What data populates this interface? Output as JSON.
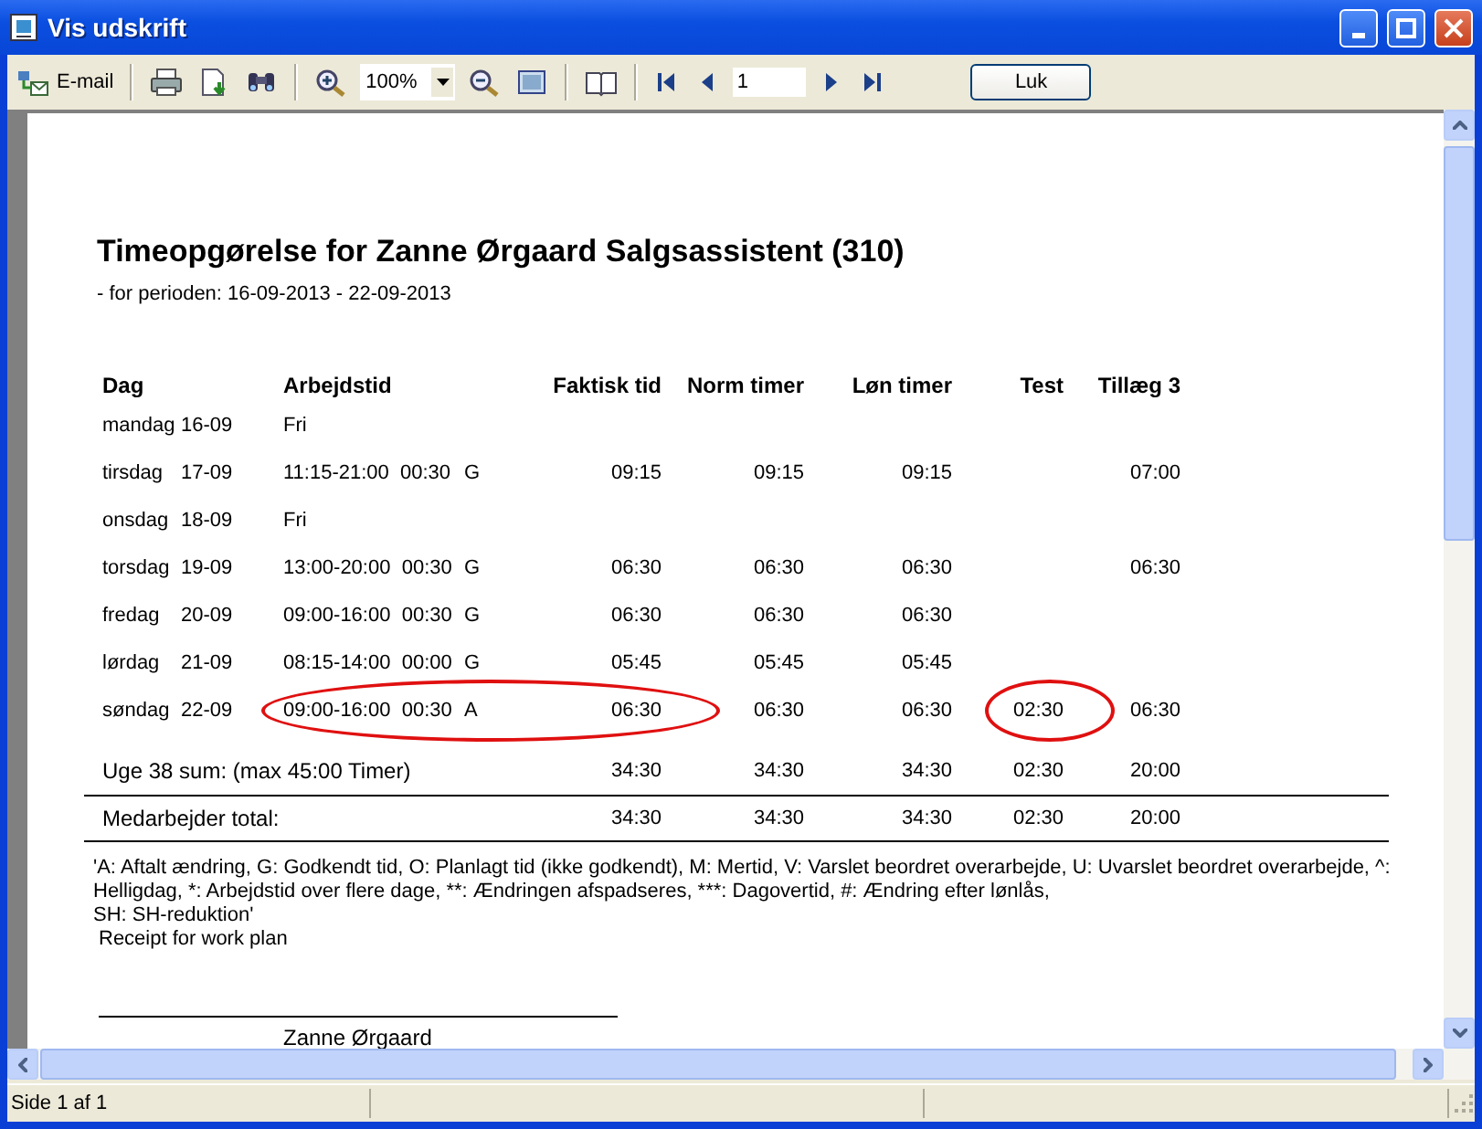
{
  "window": {
    "title": "Vis udskrift"
  },
  "toolbar": {
    "email_label": "E-mail",
    "zoom": "100%",
    "page": "1",
    "close_button": "Luk"
  },
  "report": {
    "title": "Timeopgørelse for Zanne Ørgaard Salgsassistent (310)",
    "subtitle": "- for perioden: 16-09-2013 - 22-09-2013",
    "columns": [
      "Dag",
      "Arbejdstid",
      "Faktisk tid",
      "Norm timer",
      "Løn timer",
      "Test",
      "Tillæg 3"
    ],
    "rows": [
      {
        "day": "mandag",
        "date": "16-09",
        "worktime": "Fri"
      },
      {
        "day": "tirsdag",
        "date": "17-09",
        "worktime": "11:15-21:00  00:30",
        "code": "G",
        "actual": "09:15",
        "norm": "09:15",
        "pay": "09:15",
        "extra3": "07:00"
      },
      {
        "day": "onsdag",
        "date": "18-09",
        "worktime": "Fri"
      },
      {
        "day": "torsdag",
        "date": "19-09",
        "worktime": "13:00-20:00  00:30",
        "code": "G",
        "actual": "06:30",
        "norm": "06:30",
        "pay": "06:30",
        "extra3": "06:30"
      },
      {
        "day": "fredag",
        "date": "20-09",
        "worktime": "09:00-16:00  00:30",
        "code": "G",
        "actual": "06:30",
        "norm": "06:30",
        "pay": "06:30"
      },
      {
        "day": "lørdag",
        "date": "21-09",
        "worktime": "08:15-14:00  00:00",
        "code": "G",
        "actual": "05:45",
        "norm": "05:45",
        "pay": "05:45"
      },
      {
        "day": "søndag",
        "date": "22-09",
        "worktime": "09:00-16:00  00:30",
        "code": "A",
        "actual": "06:30",
        "norm": "06:30",
        "pay": "06:30",
        "test": "02:30",
        "extra3": "06:30",
        "circled": true
      }
    ],
    "totals": [
      {
        "label": "Uge 38 sum: (max 45:00 Timer)",
        "actual": "34:30",
        "norm": "34:30",
        "pay": "34:30",
        "test": "02:30",
        "extra3": "20:00"
      },
      {
        "label": "Medarbejder total:",
        "actual": "34:30",
        "norm": "34:30",
        "pay": "34:30",
        "test": "02:30",
        "extra3": "20:00"
      }
    ],
    "legend": "'A: Aftalt ændring, G: Godkendt tid, O: Planlagt tid (ikke godkendt), M: Mertid, V: Varslet beordret overarbejde, U: Uvarslet beordret overarbejde, ^:\nHelligdag, *: Arbejdstid over flere dage, **: Ændringen afspadseres, ***: Dagovertid, #: Ændring efter lønlås,\nSH: SH-reduktion'",
    "receipt": "Receipt for work plan",
    "signature": "Zanne Ørgaard"
  },
  "status_bar": {
    "page_info": "Side 1 af 1"
  }
}
